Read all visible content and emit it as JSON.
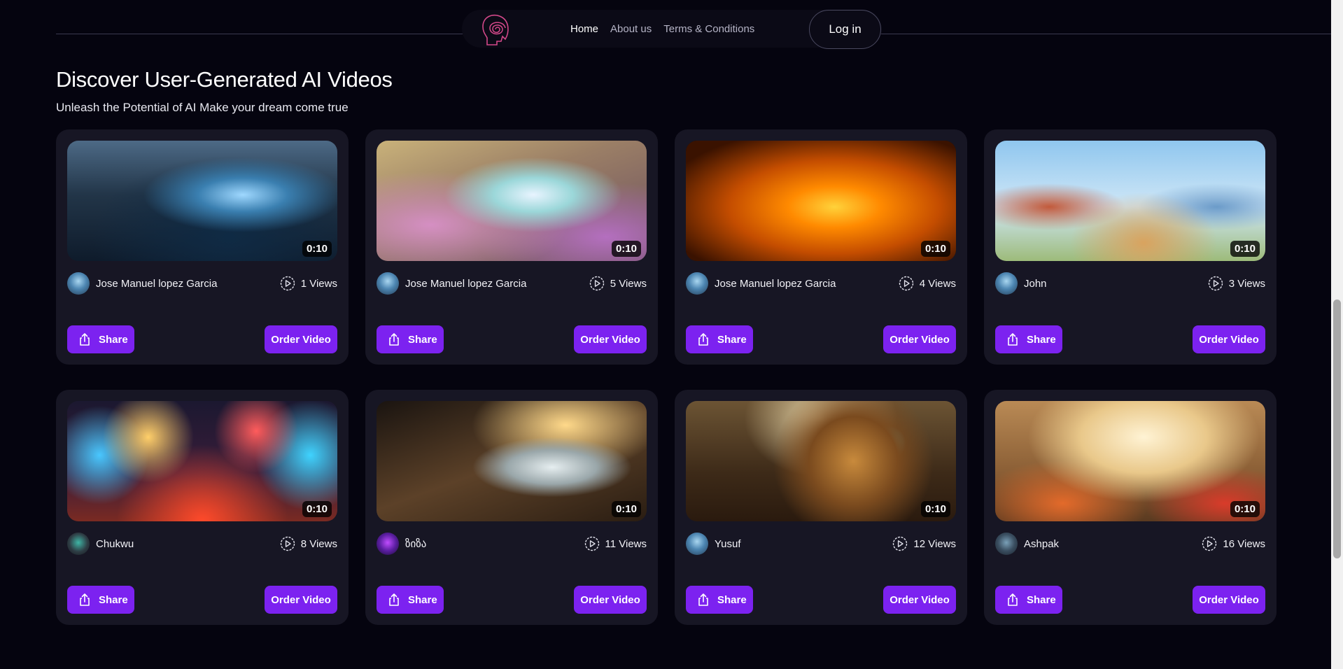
{
  "nav": {
    "links": [
      {
        "label": "Home",
        "active": true
      },
      {
        "label": "About us",
        "active": false
      },
      {
        "label": "Terms & Conditions",
        "active": false
      }
    ],
    "login_label": "Log in"
  },
  "page": {
    "title": "Discover User-Generated AI Videos",
    "subtitle": "Unleash the Potential of AI Make your dream come true"
  },
  "colors": {
    "background": "#05040f",
    "card": "#171624",
    "accent": "#7c22f0",
    "logo": "#d4488a"
  },
  "videos": [
    {
      "duration": "0:10",
      "author": "Jose Manuel lopez Garcia",
      "views": "1 Views",
      "share_label": "Share",
      "order_label": "Order Video",
      "scene": "tech-device",
      "avatar": "alien-avatar"
    },
    {
      "duration": "0:10",
      "author": "Jose Manuel lopez Garcia",
      "views": "5 Views",
      "share_label": "Share",
      "order_label": "Order Video",
      "scene": "fairy-flowers",
      "avatar": "alien-avatar"
    },
    {
      "duration": "0:10",
      "author": "Jose Manuel lopez Garcia",
      "views": "4 Views",
      "share_label": "Share",
      "order_label": "Order Video",
      "scene": "sunset-tree",
      "avatar": "alien-avatar"
    },
    {
      "duration": "0:10",
      "author": "John",
      "views": "3 Views",
      "share_label": "Share",
      "order_label": "Order Video",
      "scene": "kids-dog",
      "avatar": "alien-avatar"
    },
    {
      "duration": "0:10",
      "author": "Chukwu",
      "views": "8 Views",
      "share_label": "Share",
      "order_label": "Order Video",
      "scene": "fireworks",
      "avatar": "robot-avatar"
    },
    {
      "duration": "0:10",
      "author": "ზიზა",
      "views": "11 Views",
      "share_label": "Share",
      "order_label": "Order Video",
      "scene": "water-glass",
      "avatar": "neon-avatar"
    },
    {
      "duration": "0:10",
      "author": "Yusuf",
      "views": "12 Views",
      "share_label": "Share",
      "order_label": "Order Video",
      "scene": "steampunk-machine",
      "avatar": "alien-avatar"
    },
    {
      "duration": "0:10",
      "author": "Ashpak",
      "views": "16 Views",
      "share_label": "Share",
      "order_label": "Order Video",
      "scene": "baby-kitchen",
      "avatar": "hero-avatar"
    }
  ]
}
